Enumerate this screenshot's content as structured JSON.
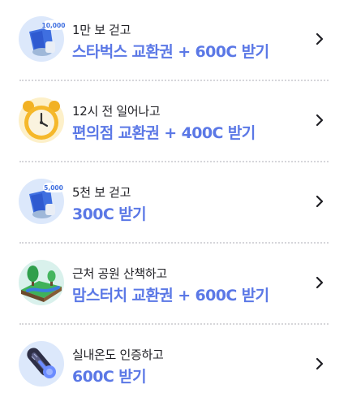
{
  "missions": [
    {
      "icon": "cup-10000-steps-icon",
      "badge": "10,000",
      "subtitle": "1만 보 걷고",
      "reward": "스타벅스 교환권 + 600C 받기"
    },
    {
      "icon": "alarm-clock-icon",
      "subtitle": "12시 전 일어나고",
      "reward": "편의점 교환권 + 400C 받기"
    },
    {
      "icon": "cup-5000-steps-icon",
      "badge": "5,000",
      "subtitle": "5천 보 걷고",
      "reward": "300C 받기"
    },
    {
      "icon": "park-icon",
      "subtitle": "근처 공원 산책하고",
      "reward": "맘스터치 교환권 + 600C 받기"
    },
    {
      "icon": "thermometer-icon",
      "subtitle": "실내온도 인증하고",
      "reward": "600C 받기"
    }
  ],
  "colors": {
    "reward_text": "#5b78e6",
    "subtitle_text": "#1f1f24",
    "divider": "#d6d6da"
  }
}
